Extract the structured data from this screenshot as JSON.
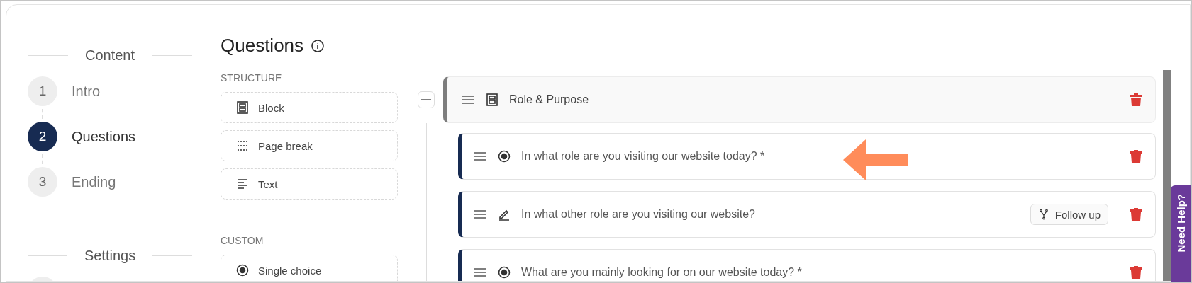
{
  "nav_sections": [
    {
      "title": "Content",
      "steps": [
        {
          "number": "1",
          "label": "Intro",
          "selected": false
        },
        {
          "number": "2",
          "label": "Questions",
          "selected": true
        },
        {
          "number": "3",
          "label": "Ending",
          "selected": false
        }
      ]
    },
    {
      "title": "Settings"
    }
  ],
  "palette": {
    "title": "Questions",
    "groups": [
      {
        "heading": "STRUCTURE",
        "items": [
          {
            "kind": "block",
            "label": "Block"
          },
          {
            "kind": "page_break",
            "label": "Page break"
          },
          {
            "kind": "text",
            "label": "Text"
          }
        ]
      },
      {
        "heading": "CUSTOM",
        "items": [
          {
            "kind": "single_choice",
            "label": "Single choice"
          }
        ]
      }
    ]
  },
  "tree": {
    "blocks": [
      {
        "title": "Role & Purpose",
        "expanded": true,
        "children": [
          {
            "kind": "single_choice",
            "text": "In what role are you visiting our website today? *"
          },
          {
            "kind": "open_text",
            "text": "In what other role are you visiting our website?",
            "action": "Follow up"
          },
          {
            "kind": "single_choice",
            "text": "What are you mainly looking for on our website today? *"
          }
        ]
      }
    ]
  },
  "help_tab": "Need Help?"
}
